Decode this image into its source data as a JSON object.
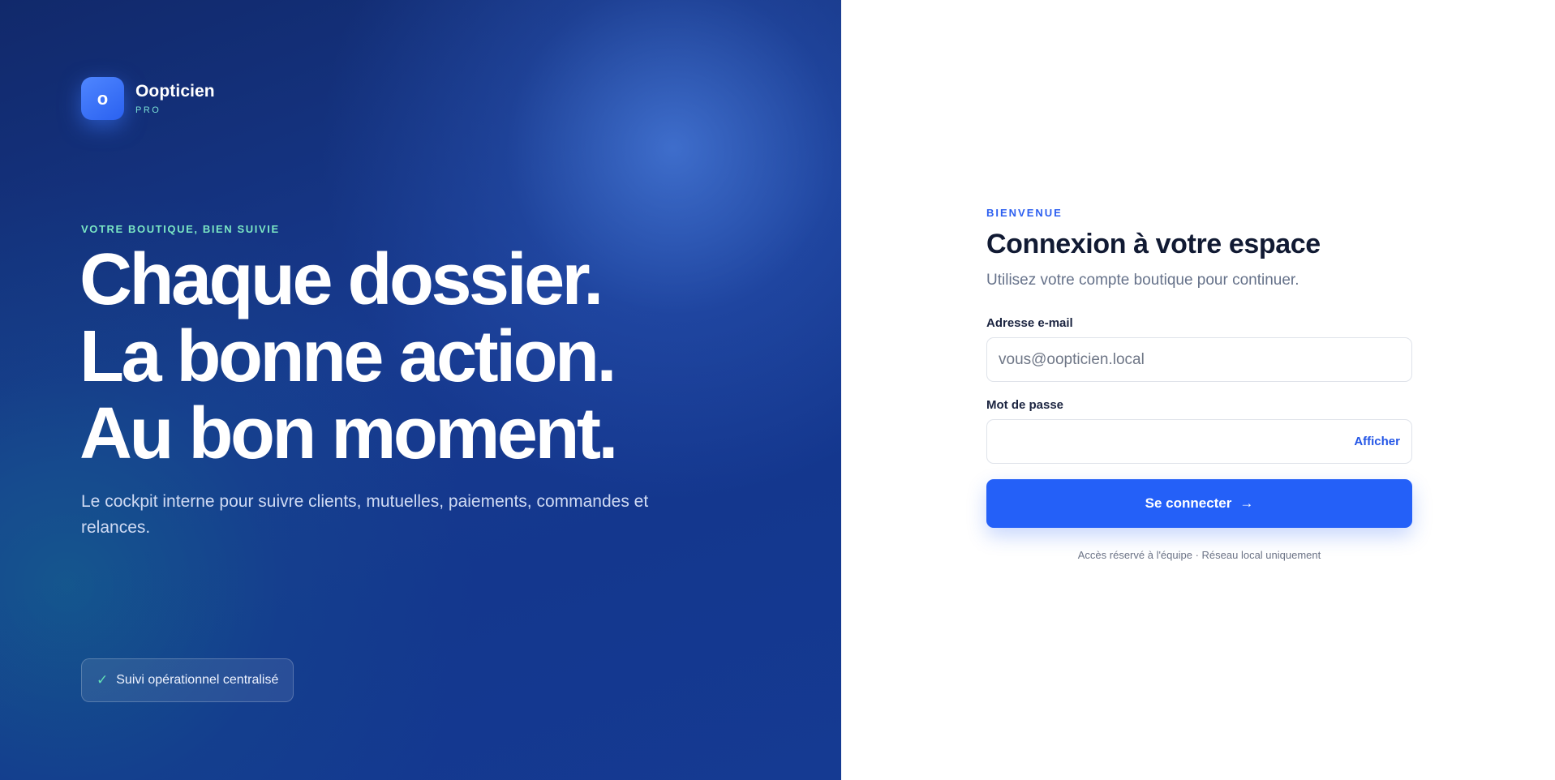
{
  "brand": {
    "logo_letter": "o",
    "name": "Oopticien",
    "tier": "PRO"
  },
  "hero": {
    "kicker": "VOTRE BOUTIQUE, BIEN SUIVIE",
    "headline": [
      "Chaque dossier.",
      "La bonne action.",
      "Au bon moment."
    ],
    "lede": "Le cockpit interne pour suivre clients, mutuelles, paiements, commandes et relances.",
    "badge": {
      "icon": "check-icon",
      "check": "✓",
      "label": "Suivi opérationnel centralisé"
    }
  },
  "login": {
    "eyebrow": "BIENVENUE",
    "title": "Connexion à votre espace",
    "subtitle": "Utilisez votre compte boutique pour continuer.",
    "email_label": "Adresse e-mail",
    "email_placeholder": "vous@oopticien.local",
    "email_value": "",
    "password_label": "Mot de passe",
    "password_value": "",
    "show_label": "Afficher",
    "submit_label": "Se connecter",
    "submit_arrow": "→",
    "footer_note": "Accès réservé à l'équipe · Réseau local uniquement"
  },
  "colors": {
    "accent": "#2460f8",
    "hero_bg": "#173a8f",
    "kicker": "#7be7c4"
  }
}
